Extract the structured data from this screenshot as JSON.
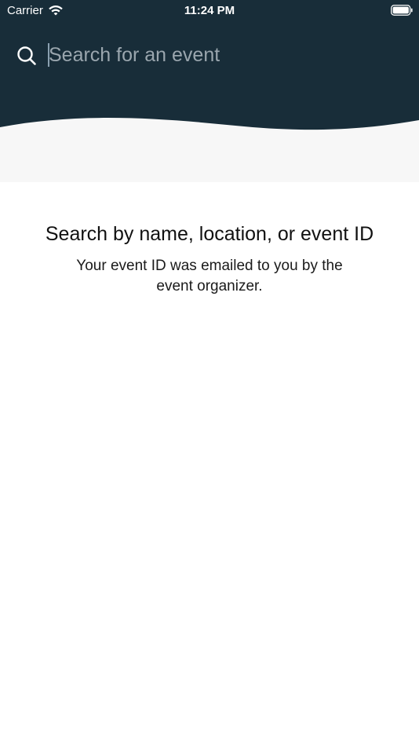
{
  "status_bar": {
    "carrier": "Carrier",
    "time": "11:24 PM",
    "wifi_icon": "wifi-icon",
    "battery_icon": "battery-icon"
  },
  "search": {
    "icon": "search-icon",
    "placeholder": "Search for an event",
    "value": ""
  },
  "empty_state": {
    "title": "Search by name, location, or event ID",
    "subtitle": "Your event ID was emailed to you by the event organizer."
  },
  "colors": {
    "header": "#182d39",
    "page_background": "#ffffff",
    "wave_band": "#f7f7f7"
  }
}
